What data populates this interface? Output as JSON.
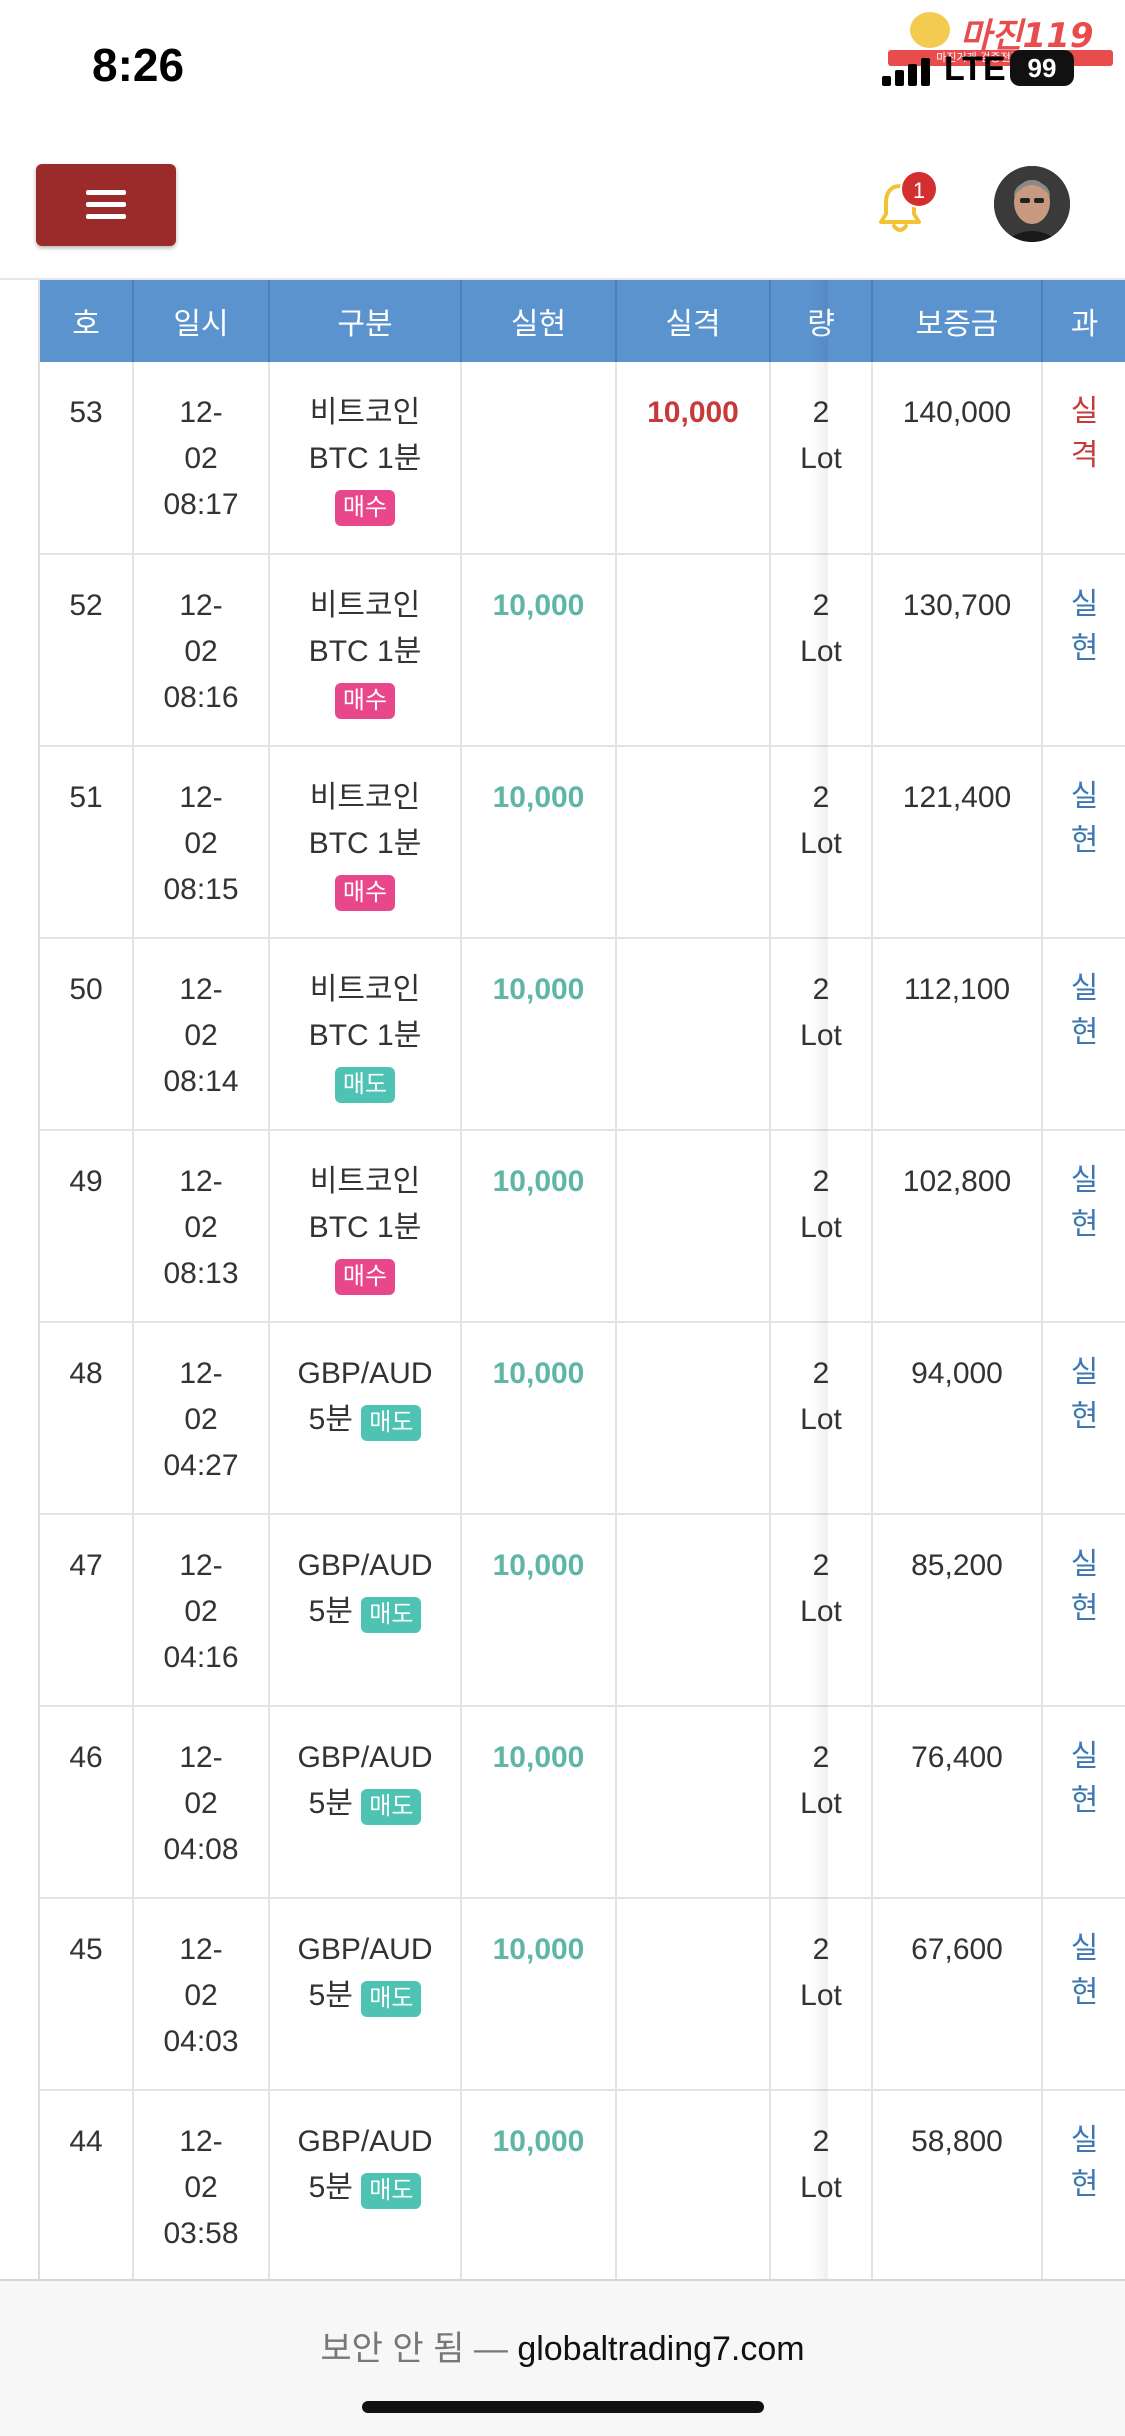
{
  "status_bar": {
    "time": "8:26",
    "network": "LTE",
    "battery": "99"
  },
  "watermark": {
    "main": "마진119",
    "sub": "마진거래 검증전문 커뮤니티"
  },
  "header": {
    "notification_count": "1"
  },
  "table": {
    "columns": [
      "호",
      "일시",
      "구분",
      "실현",
      "실격",
      "량",
      "보증금",
      "과"
    ],
    "rows": [
      {
        "no": "53",
        "date": "12-",
        "date2": "02",
        "time": "08:17",
        "product": "비트코인",
        "product2": "BTC 1분",
        "side": "매수",
        "side_type": "buy",
        "realized": "",
        "loss": "10,000",
        "qty": "2",
        "qty_unit": "Lot",
        "margin": "140,000",
        "result": "실",
        "result2": "격",
        "result_type": "loss"
      },
      {
        "no": "52",
        "date": "12-",
        "date2": "02",
        "time": "08:16",
        "product": "비트코인",
        "product2": "BTC 1분",
        "side": "매수",
        "side_type": "buy",
        "realized": "10,000",
        "loss": "",
        "qty": "2",
        "qty_unit": "Lot",
        "margin": "130,700",
        "result": "실",
        "result2": "현",
        "result_type": "realized"
      },
      {
        "no": "51",
        "date": "12-",
        "date2": "02",
        "time": "08:15",
        "product": "비트코인",
        "product2": "BTC 1분",
        "side": "매수",
        "side_type": "buy",
        "realized": "10,000",
        "loss": "",
        "qty": "2",
        "qty_unit": "Lot",
        "margin": "121,400",
        "result": "실",
        "result2": "현",
        "result_type": "realized"
      },
      {
        "no": "50",
        "date": "12-",
        "date2": "02",
        "time": "08:14",
        "product": "비트코인",
        "product2": "BTC 1분",
        "side": "매도",
        "side_type": "sell",
        "realized": "10,000",
        "loss": "",
        "qty": "2",
        "qty_unit": "Lot",
        "margin": "112,100",
        "result": "실",
        "result2": "현",
        "result_type": "realized"
      },
      {
        "no": "49",
        "date": "12-",
        "date2": "02",
        "time": "08:13",
        "product": "비트코인",
        "product2": "BTC 1분",
        "side": "매수",
        "side_type": "buy",
        "realized": "10,000",
        "loss": "",
        "qty": "2",
        "qty_unit": "Lot",
        "margin": "102,800",
        "result": "실",
        "result2": "현",
        "result_type": "realized"
      },
      {
        "no": "48",
        "date": "12-",
        "date2": "02",
        "time": "04:27",
        "product": "GBP/AUD",
        "product2": "5분",
        "side": "매도",
        "side_type": "sell",
        "realized": "10,000",
        "loss": "",
        "qty": "2",
        "qty_unit": "Lot",
        "margin": "94,000",
        "result": "실",
        "result2": "현",
        "result_type": "realized"
      },
      {
        "no": "47",
        "date": "12-",
        "date2": "02",
        "time": "04:16",
        "product": "GBP/AUD",
        "product2": "5분",
        "side": "매도",
        "side_type": "sell",
        "realized": "10,000",
        "loss": "",
        "qty": "2",
        "qty_unit": "Lot",
        "margin": "85,200",
        "result": "실",
        "result2": "현",
        "result_type": "realized"
      },
      {
        "no": "46",
        "date": "12-",
        "date2": "02",
        "time": "04:08",
        "product": "GBP/AUD",
        "product2": "5분",
        "side": "매도",
        "side_type": "sell",
        "realized": "10,000",
        "loss": "",
        "qty": "2",
        "qty_unit": "Lot",
        "margin": "76,400",
        "result": "실",
        "result2": "현",
        "result_type": "realized"
      },
      {
        "no": "45",
        "date": "12-",
        "date2": "02",
        "time": "04:03",
        "product": "GBP/AUD",
        "product2": "5분",
        "side": "매도",
        "side_type": "sell",
        "realized": "10,000",
        "loss": "",
        "qty": "2",
        "qty_unit": "Lot",
        "margin": "67,600",
        "result": "실",
        "result2": "현",
        "result_type": "realized"
      },
      {
        "no": "44",
        "date": "12-",
        "date2": "02",
        "time": "03:58",
        "product": "GBP/AUD",
        "product2": "5분",
        "side": "매도",
        "side_type": "sell",
        "realized": "10,000",
        "loss": "",
        "qty": "2",
        "qty_unit": "Lot",
        "margin": "58,800",
        "result": "실",
        "result2": "현",
        "result_type": "realized"
      }
    ]
  },
  "address_bar": {
    "insecure_label": "보안 안 됨 —",
    "domain": "globaltrading7.com"
  },
  "colors": {
    "header_blue": "#5b93cf",
    "menu_red": "#9b2b2b",
    "realized_green": "#5fb5a6",
    "loss_red": "#c83a3a",
    "buy_pink": "#e9478b",
    "sell_teal": "#4ec3b4",
    "result_blue": "#3e78b3"
  }
}
